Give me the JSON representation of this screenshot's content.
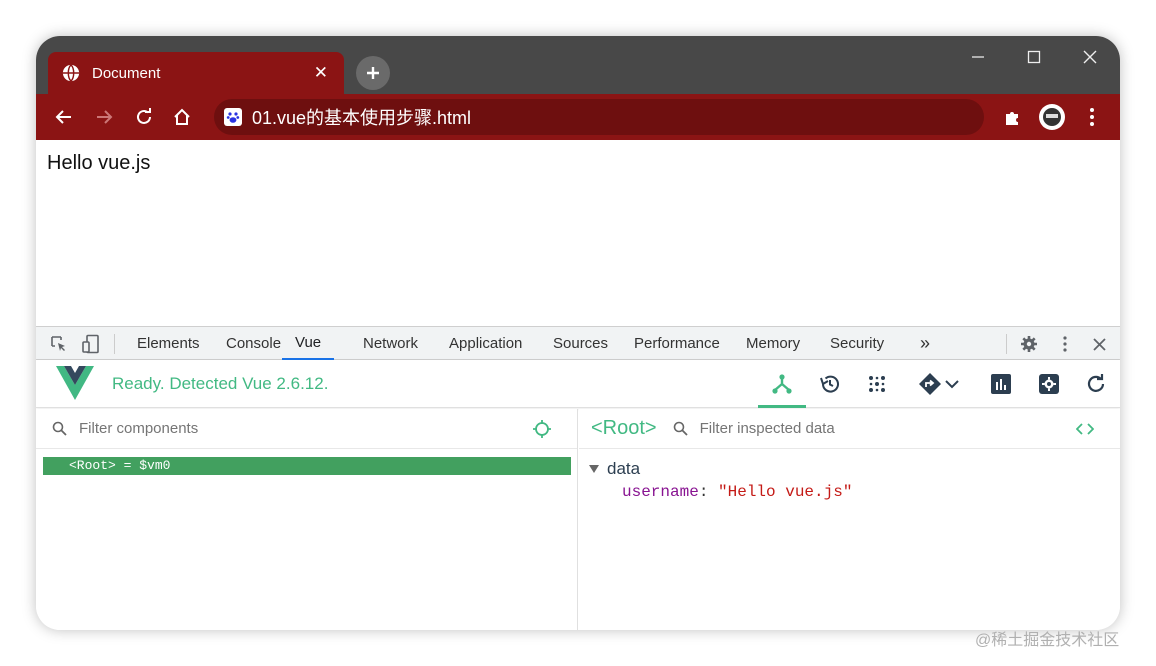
{
  "browser": {
    "tab_title": "Document",
    "tab_close": "✕",
    "new_tab": "+",
    "address": "01.vue的基本使用步骤.html"
  },
  "page": {
    "content_text": "Hello vue.js"
  },
  "devtools": {
    "tabs": [
      "Elements",
      "Console",
      "Vue",
      "Network",
      "Application",
      "Sources",
      "Performance",
      "Memory",
      "Security"
    ],
    "active_tab": "Vue",
    "more_tabs": "»"
  },
  "vue": {
    "status": "Ready. Detected Vue 2.6.12.",
    "left": {
      "filter_placeholder": "Filter components",
      "root_row": "<Root> = $vm0"
    },
    "right": {
      "selected": "<Root>",
      "filter_placeholder": "Filter inspected data",
      "section": "data",
      "prop_key": "username",
      "prop_value": "\"Hello vue.js\""
    }
  },
  "colors": {
    "brand": "#8b1414",
    "vue_green": "#42b983"
  },
  "watermark": "@稀土掘金技术社区"
}
